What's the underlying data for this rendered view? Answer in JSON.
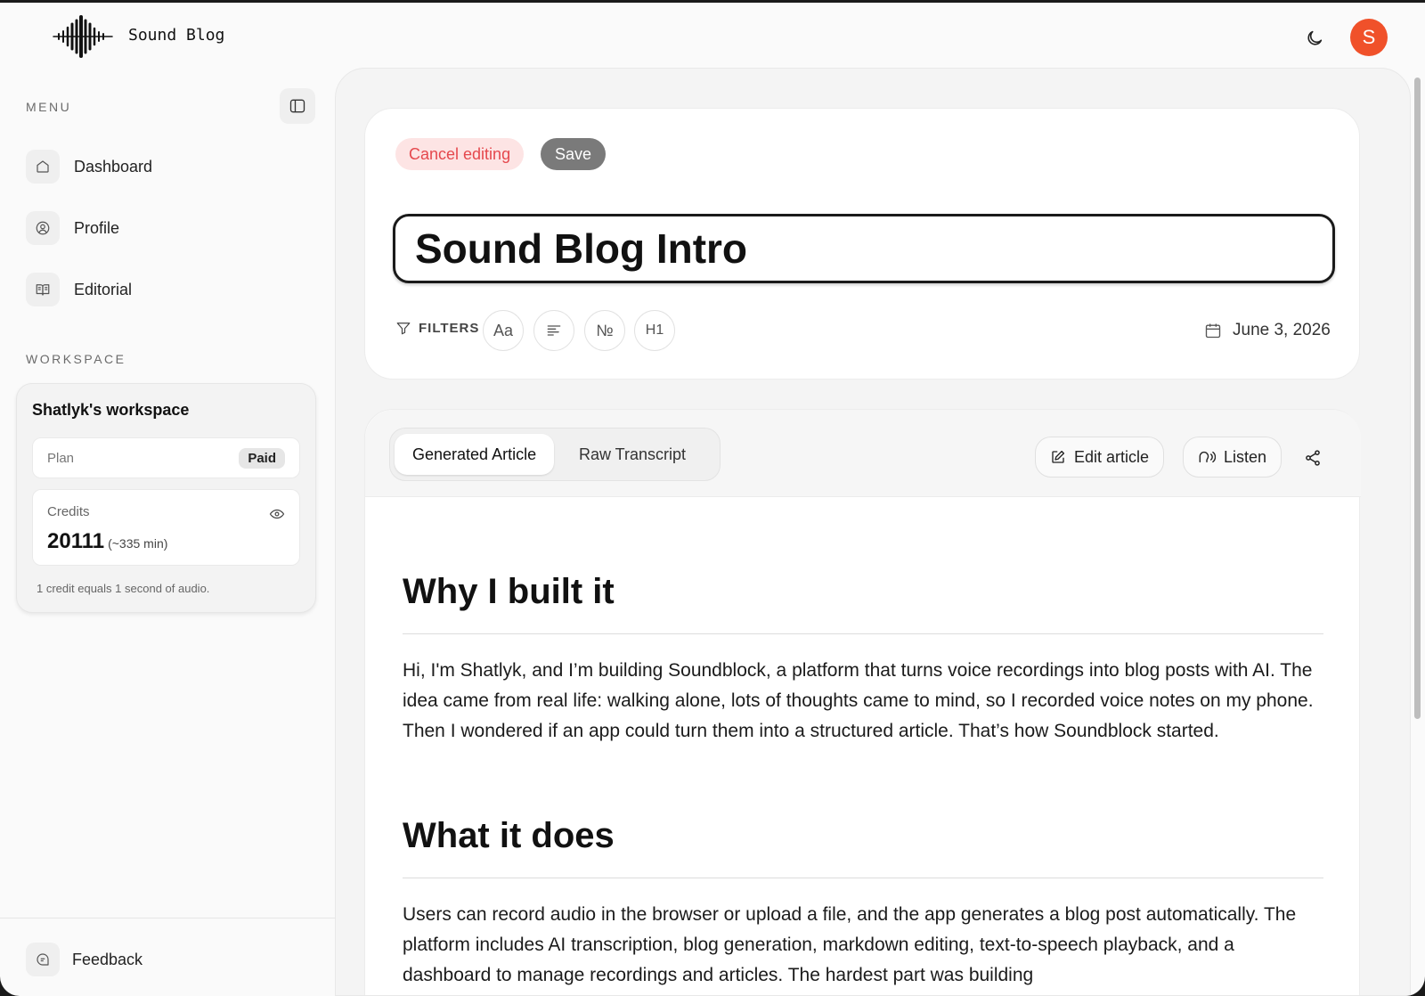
{
  "header": {
    "brand": "Sound Blog",
    "avatar_initial": "S",
    "avatar_color": "#f0512a"
  },
  "sidebar": {
    "menu_label": "MENU",
    "items": [
      {
        "label": "Dashboard",
        "icon": "home-icon"
      },
      {
        "label": "Profile",
        "icon": "user-circle-icon"
      },
      {
        "label": "Editorial",
        "icon": "book-open-icon"
      }
    ],
    "workspace_label": "WORKSPACE",
    "workspace": {
      "title": "Shatlyk's workspace",
      "plan_label": "Plan",
      "plan_value": "Paid",
      "credits_label": "Credits",
      "credits_value": "20111",
      "credits_minutes": "(~335 min)",
      "credits_note": "1 credit equals 1 second of audio."
    },
    "feedback_label": "Feedback"
  },
  "editor": {
    "cancel_label": "Cancel editing",
    "save_label": "Save",
    "title_value": "Sound Blog Intro",
    "filters_label": "FILTERS",
    "format_buttons": [
      {
        "glyph": "Aa",
        "icon": "font-case-icon"
      },
      {
        "glyph": "",
        "icon": "align-left-icon"
      },
      {
        "glyph": "№",
        "icon": "numero-icon"
      },
      {
        "glyph": "H1",
        "icon": "heading-icon"
      }
    ],
    "date": "June 3, 2026"
  },
  "article": {
    "tabs": [
      {
        "label": "Generated Article",
        "active": true
      },
      {
        "label": "Raw Transcript",
        "active": false
      }
    ],
    "edit_label": "Edit article",
    "listen_label": "Listen",
    "sections": [
      {
        "heading": "Why I built it",
        "body": "Hi, I'm Shatlyk, and I’m building Soundblock, a platform that turns voice recordings into blog posts with AI. The idea came from real life: walking alone, lots of thoughts came to mind, so I recorded voice notes on my phone. Then I wondered if an app could turn them into a structured article. That’s how Soundblock started."
      },
      {
        "heading": "What it does",
        "body": "Users can record audio in the browser or upload a file, and the app generates a blog post automatically. The platform includes AI transcription, blog generation, markdown editing, text-to-speech playback, and a dashboard to manage recordings and articles. The hardest part was building"
      }
    ]
  },
  "colors": {
    "cancel_text": "#e5484d",
    "cancel_bg": "#fde4e4",
    "save_bg": "#7a7a7a"
  }
}
